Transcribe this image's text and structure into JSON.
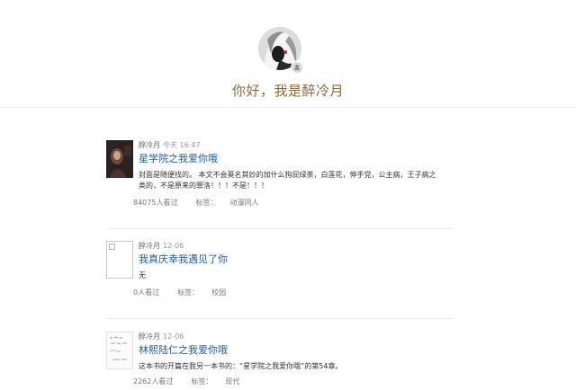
{
  "profile": {
    "greeting": "你好，我是醉冷月"
  },
  "posts": [
    {
      "author": "醉冷月",
      "time": "今天 16:47",
      "title": "星学院之我爱你哦",
      "summary_line1": "封面是随便找的。 本文不会莫名其妙的加什么狗屁绿茶，白莲花，伸手党，公主病，王子病之",
      "summary_line2": "类的，不是原来的罪洛！！！不是！！！",
      "views": "84075人看过",
      "tag_label": "标签：",
      "tag": "动漫同人"
    },
    {
      "author": "醉冷月",
      "time": "12-06",
      "title": "我真庆幸我遇见了你",
      "summary_line1": "无",
      "views": "0人看过",
      "tag_label": "标签：",
      "tag": "校园"
    },
    {
      "author": "醉冷月",
      "time": "12-06",
      "title": "林熙陆仁之我爱你哦",
      "summary_line1": "这本书的开篇在我另一本书的：“星学院之我爱你哦”的第54章。",
      "views": "2262人看过",
      "tag_label": "标签：",
      "tag": "现代"
    }
  ]
}
